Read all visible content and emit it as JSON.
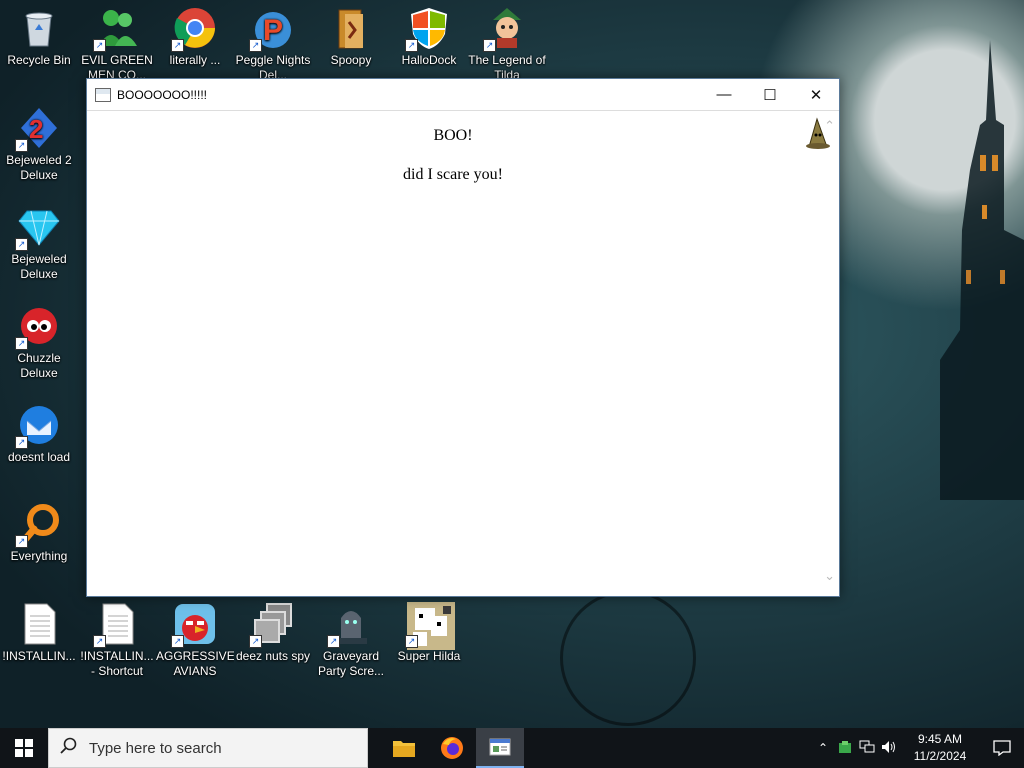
{
  "desktop": {
    "icons": [
      {
        "label": "Recycle Bin",
        "icon": "recycle-bin-icon"
      },
      {
        "label": "EVIL GREEN MEN CO...",
        "icon": "green-men-icon"
      },
      {
        "label": "literally ...",
        "icon": "chrome-icon"
      },
      {
        "label": "Peggle Nights Del...",
        "icon": "peggle-icon"
      },
      {
        "label": "Spoopy",
        "icon": "spoopy-icon"
      },
      {
        "label": "HalloDock",
        "icon": "windows-shield-icon"
      },
      {
        "label": "The Legend of Tilda",
        "icon": "legend-icon"
      },
      {
        "label": "Bejeweled 2 Deluxe",
        "icon": "bejeweled2-icon"
      },
      {
        "label": "Bejeweled Deluxe",
        "icon": "bejeweled-icon"
      },
      {
        "label": "Chuzzle Deluxe",
        "icon": "chuzzle-icon"
      },
      {
        "label": "doesnt load",
        "icon": "thunderbird-icon"
      },
      {
        "label": "Everything",
        "icon": "everything-icon"
      },
      {
        "label": "!INSTALLIN...",
        "icon": "text-file-icon"
      },
      {
        "label": "!INSTALLIN... - Shortcut",
        "icon": "text-file-icon"
      },
      {
        "label": "AGGRESSIVE AVIANS",
        "icon": "angry-bird-icon"
      },
      {
        "label": "deez nuts spy",
        "icon": "window-stack-icon"
      },
      {
        "label": "Graveyard Party Scre...",
        "icon": "graveyard-icon"
      },
      {
        "label": "Super Hilda",
        "icon": "pixel-dog-icon"
      }
    ]
  },
  "window": {
    "title": "BOOOOOOO!!!!!",
    "heading": "BOO!",
    "message": "did I scare you!",
    "min_glyph": "—",
    "max_glyph": "☐",
    "close_glyph": "✕"
  },
  "taskbar": {
    "search_placeholder": "Type here to search",
    "time": "9:45 AM",
    "date": "11/2/2024"
  }
}
